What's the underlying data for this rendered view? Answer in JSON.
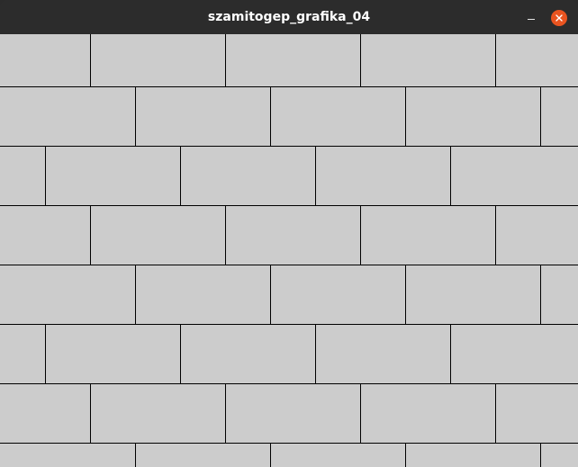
{
  "window": {
    "title": "szamitogep_grafika_04"
  },
  "titlebar_buttons": {
    "minimize_icon": "minimize-icon",
    "close_icon": "close-icon",
    "close_color": "#e95420"
  },
  "canvas": {
    "background_color": "#cccccc",
    "line_color": "#000000",
    "pattern": "brick-wall"
  }
}
